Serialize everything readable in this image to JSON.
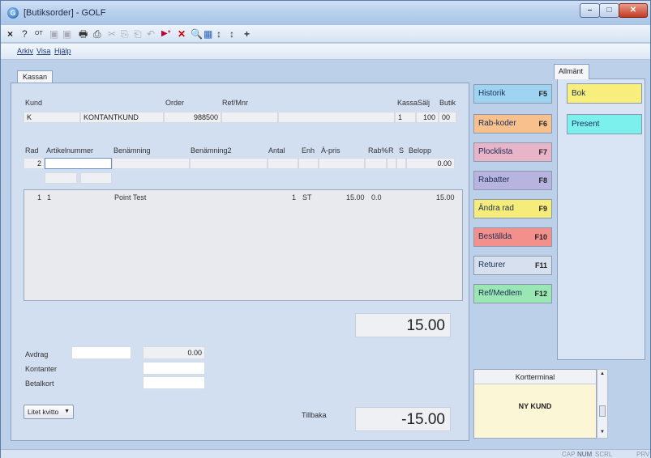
{
  "window": {
    "title": "[Butiksorder] - GOLF",
    "min": "–",
    "max": "□",
    "close": "✕"
  },
  "toolbar": [
    "×",
    "?",
    "OT",
    "▣",
    "▣",
    "🖶",
    "⎙",
    "✂",
    "⎘",
    "⎗",
    "↶",
    "▶*",
    "✕",
    "🔍",
    "▦",
    "↕",
    "↕",
    "+"
  ],
  "menu": {
    "arkiv": "Arkiv",
    "visa": "Visa",
    "hjalp": "Hjälp"
  },
  "tab": {
    "kassan": "Kassan"
  },
  "header": {
    "kund_label": "Kund",
    "order_label": "Order",
    "ref_label": "Ref/Mnr",
    "kassa_label": "Kassa",
    "salj_label": "Sälj",
    "butik_label": "Butik",
    "kund": "K",
    "kund_namn": "KONTANTKUND",
    "order": "988500",
    "ref": "",
    "kassa": "1",
    "salj": "100",
    "butik": "00"
  },
  "columns": {
    "rad": "Rad",
    "artikelnummer": "Artikelnummer",
    "benamning": "Benämning",
    "benamning2": "Benämning2",
    "antal": "Antal",
    "enh": "Enh",
    "apris": "À-pris",
    "rab": "Rab%",
    "r": "R",
    "s": "S",
    "belopp": "Belopp"
  },
  "entry": {
    "rad": "2",
    "artikel": "",
    "belopp": "0.00"
  },
  "rows": [
    {
      "rad": "1",
      "art": "1",
      "benamning": "Point Test",
      "antal": "1",
      "enh": "ST",
      "apris": "15.00",
      "rab": "0.0",
      "belopp": "15.00"
    }
  ],
  "total": "15.00",
  "payment": {
    "avdrag_label": "Avdrag",
    "avdrag_value": "0.00",
    "kontanter_label": "Kontanter",
    "betalkort_label": "Betalkort",
    "tillbaka_label": "Tillbaka",
    "tillbaka_value": "-15.00"
  },
  "receipt_select": "Litet kvitto",
  "fbuttons": [
    {
      "label": "Historik",
      "key": "F5",
      "color": "#9fd3f2"
    },
    {
      "label": "Rab-koder",
      "key": "F6",
      "color": "#f7c08c"
    },
    {
      "label": "Plocklista",
      "key": "F7",
      "color": "#e8b4c8"
    },
    {
      "label": "Rabatter",
      "key": "F8",
      "color": "#b8b4e0"
    },
    {
      "label": "Ändra rad",
      "key": "F9",
      "color": "#f6ec7a"
    },
    {
      "label": "Beställda",
      "key": "F10",
      "color": "#f3908c"
    },
    {
      "label": "Returer",
      "key": "F11",
      "color": "#d7e0ee"
    },
    {
      "label": "Ref/Medlem",
      "key": "F12",
      "color": "#9ae7b4"
    }
  ],
  "right": {
    "tab": "Allmänt",
    "bok": "Bok",
    "present": "Present"
  },
  "kortterminal": {
    "title": "Kortterminal",
    "message": "NY KUND"
  },
  "status": {
    "cap": "CAP",
    "num": "NUM",
    "scrl": "SCRL",
    "prv": "PRV"
  }
}
